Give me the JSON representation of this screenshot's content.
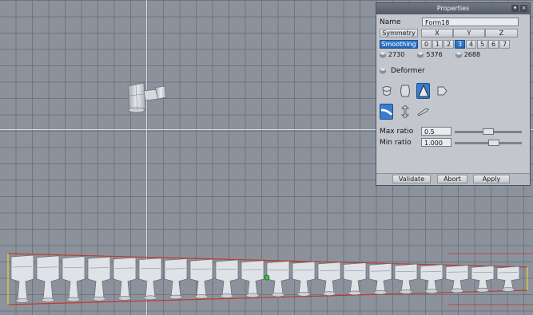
{
  "viewport": {
    "name": "3d-viewport"
  },
  "panel": {
    "title": "Properties",
    "close_glyph": "×",
    "menu_glyph": "▾",
    "name_label": "Name",
    "name_value": "Form18",
    "symmetry_label": "Symmetry",
    "axes": [
      "X",
      "Y",
      "Z"
    ],
    "smoothing_label": "Smoothing",
    "smoothing_levels": [
      "0",
      "1",
      "2",
      "3",
      "4",
      "5",
      "6",
      "7"
    ],
    "smoothing_selected": "3",
    "counts": [
      "2730",
      "5376",
      "2688"
    ],
    "deformer_label": "Deformer",
    "tool_icons_row1": [
      "twist-icon",
      "bulge-icon",
      "taper-icon",
      "bend-shape-icon"
    ],
    "tool_icons_row2": [
      "bend-icon",
      "stretch-icon",
      "tool-icon"
    ],
    "max_ratio_label": "Max ratio",
    "max_ratio_value": "0.5",
    "max_ratio_fraction": 0.5,
    "min_ratio_label": "Min ratio",
    "min_ratio_value": "1.000",
    "min_ratio_fraction": 0.6,
    "validate_label": "Validate",
    "abort_label": "Abort",
    "apply_label": "Apply"
  },
  "colors": {
    "accent": "#2f6fc0",
    "selection_outline": "#c0392b",
    "pivot": "#2ecc40"
  }
}
